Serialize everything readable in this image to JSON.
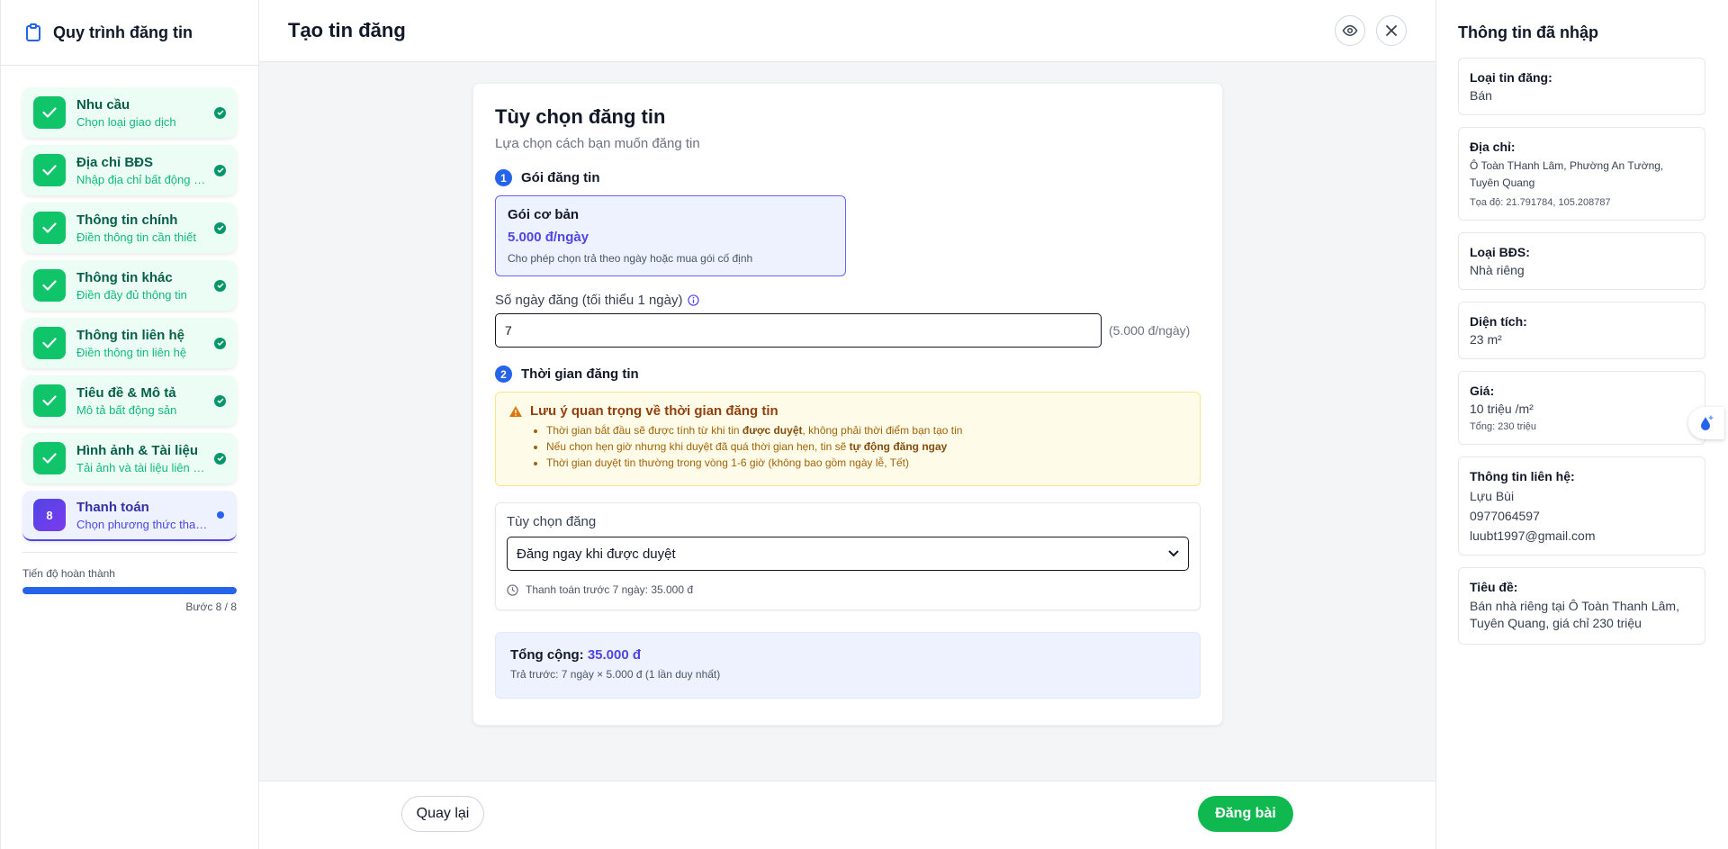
{
  "sidebar": {
    "title": "Quy trình đăng tin",
    "steps": [
      {
        "title": "Nhu cầu",
        "subtitle": "Chọn loại giao dịch"
      },
      {
        "title": "Địa chỉ BĐS",
        "subtitle": "Nhập địa chỉ bất động sản"
      },
      {
        "title": "Thông tin chính",
        "subtitle": "Điền thông tin cần thiết"
      },
      {
        "title": "Thông tin khác",
        "subtitle": "Điền đầy đủ thông tin"
      },
      {
        "title": "Thông tin liên hệ",
        "subtitle": "Điền thông tin liên hệ"
      },
      {
        "title": "Tiêu đề & Mô tả",
        "subtitle": "Mô tả bất động sản"
      },
      {
        "title": "Hình ảnh & Tài liệu",
        "subtitle": "Tải ảnh và tài liệu liên quan"
      },
      {
        "number": "8",
        "title": "Thanh toán",
        "subtitle": "Chọn phương thức thanh toán"
      }
    ],
    "progress_label": "Tiến độ hoàn thành",
    "progress_fraction": 1.0,
    "progress_text": "Bước 8 / 8"
  },
  "header": {
    "title": "Tạo tin đăng"
  },
  "main": {
    "title": "Tùy chọn đăng tin",
    "subtitle": "Lựa chọn cách bạn muốn đăng tin",
    "section1": {
      "number": "1",
      "title": "Gói đăng tin"
    },
    "package": {
      "name": "Gói cơ bản",
      "price": "5.000 đ/ngày",
      "desc": "Cho phép chọn trả theo ngày hoặc mua gói cố định"
    },
    "days_label": "Số ngày đăng (tối thiểu 1 ngày)",
    "days_value": "7",
    "days_rate": "(5.000 đ/ngày)",
    "section2": {
      "number": "2",
      "title": "Thời gian đăng tin"
    },
    "warning": {
      "title": "Lưu ý quan trọng về thời gian đăng tin",
      "items": [
        {
          "pre": "Thời gian bắt đầu sẽ được tính từ khi tin ",
          "bold": "được duyệt",
          "post": ", không phải thời điểm bạn tạo tin"
        },
        {
          "pre": "Nếu chọn hẹn giờ nhưng khi duyệt đã quá thời gian hẹn, tin sẽ ",
          "bold": "tự động đăng ngay",
          "post": ""
        },
        {
          "pre": "Thời gian duyệt tin thường trong vòng 1-6 giờ (không bao gồm ngày lễ, Tết)",
          "bold": "",
          "post": ""
        }
      ]
    },
    "option": {
      "label": "Tùy chọn đăng",
      "selected": "Đăng ngay khi được duyệt",
      "note": "Thanh toán trước 7 ngày: 35.000 đ"
    },
    "total": {
      "label": "Tổng cộng:",
      "amount": "35.000 đ",
      "detail": "Trả trước: 7 ngày × 5.000 đ (1 lần duy nhất)"
    }
  },
  "footer": {
    "back_label": "Quay lại",
    "post_label": "Đăng bài"
  },
  "summary": {
    "title": "Thông tin đã nhập",
    "listing_type": {
      "key": "Loại tin đăng:",
      "value": "Bán"
    },
    "address": {
      "key": "Địa chỉ:",
      "value": "Ô Toàn THanh Lâm, Phường An Tường, Tuyên Quang",
      "coords": "Tọa độ: 21.791784, 105.208787"
    },
    "property_type": {
      "key": "Loại BĐS:",
      "value": "Nhà riêng"
    },
    "area": {
      "key": "Diện tích:",
      "value": "23 m²"
    },
    "price": {
      "key": "Giá:",
      "value": "10 triệu /m²",
      "total": "Tổng: 230 triệu"
    },
    "contact": {
      "key": "Thông tin liên hệ:",
      "name": "Lựu Bùi",
      "phone": "0977064597",
      "email": "luubt1997@gmail.com"
    },
    "headline": {
      "key": "Tiêu đề:",
      "value": "Bán nhà riêng tại Ô Toàn Thanh Lâm, Tuyên Quang, giá chỉ 230 triệu"
    }
  },
  "colors": {
    "accent": "#4f46e5",
    "success": "#10b950",
    "primary": "#2563eb"
  }
}
